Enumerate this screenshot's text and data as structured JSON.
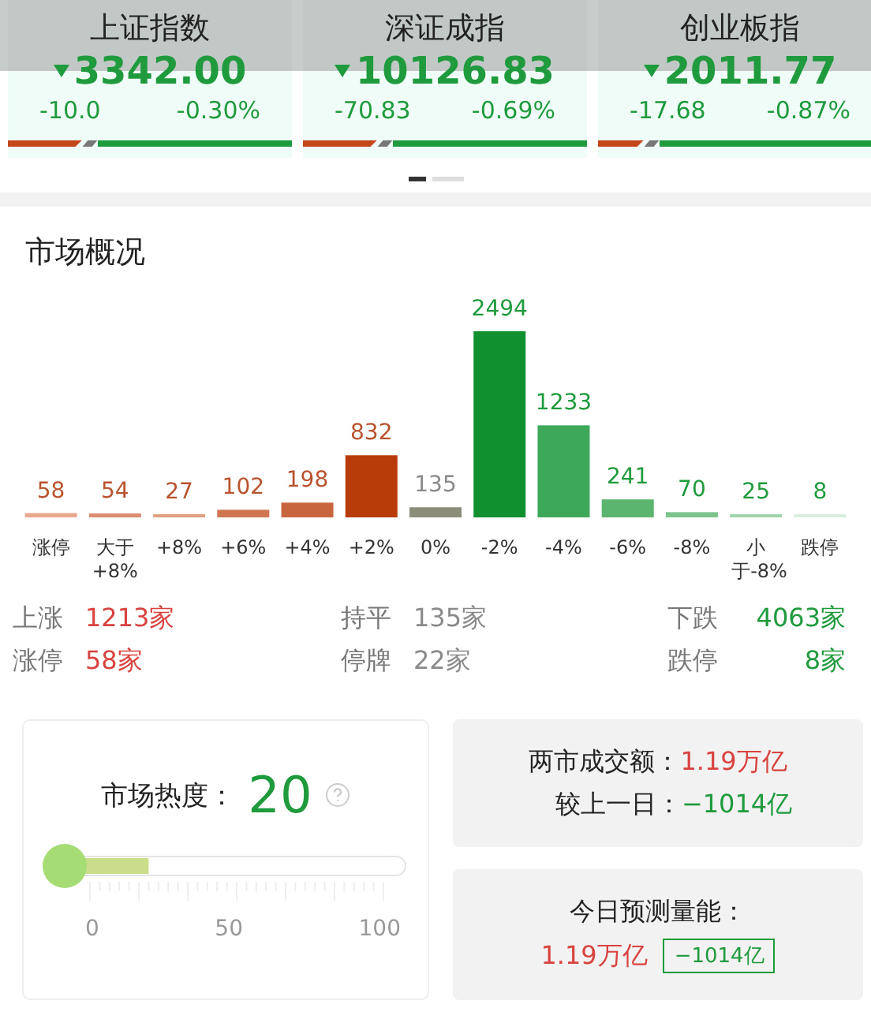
{
  "indices": [
    {
      "name": "上证指数",
      "color": "#1f9a3c",
      "price": "3342.00",
      "change": "-10.0",
      "percent": "-0.30%",
      "bar": {
        "level": 0.26
      }
    },
    {
      "name": "深证成指",
      "color": "#1f9a3c",
      "price": "10126.83",
      "change": "-70.83",
      "percent": "-0.69%",
      "bar": {
        "level": 0.26
      }
    },
    {
      "name": "创业板指",
      "color": "#1f9a3c",
      "price": "2011.77",
      "change": "-17.68",
      "percent": "-0.87%",
      "bar": {
        "level": 0.16
      }
    }
  ],
  "pager": [
    {
      "selected": true
    },
    {
      "selected": false
    }
  ],
  "overview": {
    "title": "市场概况",
    "chart_data": {
      "type": "bar",
      "categories": [
        "涨停",
        "大于+8%",
        "+8%",
        "+6%",
        "+4%",
        "+2%",
        "0%",
        "-2%",
        "-4%",
        "-6%",
        "-8%",
        "小于-8%",
        "跌停"
      ],
      "values": [
        58,
        54,
        27,
        102,
        198,
        832,
        135,
        2494,
        1233,
        241,
        70,
        25,
        8
      ],
      "data_labels": true
    },
    "bars": [
      {
        "color": "#e9a98f"
      },
      {
        "color": "#dc8e72"
      },
      {
        "color": "#e0a080"
      },
      {
        "color": "#cf7650"
      },
      {
        "color": "#c9653e"
      },
      {
        "color": "#b83c0a"
      },
      {
        "color": "#8c8c7a"
      },
      {
        "color": "#10902f"
      },
      {
        "color": "#3ea85a"
      },
      {
        "color": "#5bb56f"
      },
      {
        "color": "#7cc48c"
      },
      {
        "color": "#9fd4ab"
      },
      {
        "color": "#d9eedd"
      }
    ],
    "labels": [
      {
        "color": "#b9532e"
      },
      {
        "color": "#b9532e"
      },
      {
        "color": "#b9532e"
      },
      {
        "color": "#b9532e"
      },
      {
        "color": "#b9532e"
      },
      {
        "color": "#b9532e"
      },
      {
        "color": "#8a8a8a"
      },
      {
        "color": "#1f9a3c"
      },
      {
        "color": "#1f9a3c"
      },
      {
        "color": "#1f9a3c"
      },
      {
        "color": "#1f9a3c"
      },
      {
        "color": "#1f9a3c"
      },
      {
        "color": "#1f9a3c"
      }
    ],
    "stats": [
      {
        "label": "上涨",
        "value": "1213家",
        "color": "#d9433f"
      },
      {
        "label": "持平",
        "value": "135家",
        "color": "#8a8a8a"
      },
      {
        "label": "下跌",
        "value": "4063家",
        "color": "#1f9a3c"
      },
      {
        "label": "涨停",
        "value": "58家",
        "color": "#d9433f"
      },
      {
        "label": "停牌",
        "value": "22家",
        "color": "#8a8a8a"
      },
      {
        "label": "跌停",
        "value": "8家",
        "color": "#1f9a3c"
      }
    ]
  },
  "heat": {
    "label": "市场热度：",
    "value": "20",
    "meter": {
      "level": 0.2
    },
    "ticks": [
      "0",
      "50",
      "100"
    ]
  },
  "turnover": {
    "rows": [
      {
        "label": "两市成交额：",
        "value": "1.19万亿",
        "color": "#d9433f"
      },
      {
        "label": "较上一日：",
        "value": "−1014亿",
        "color": "#1f9a3c"
      }
    ]
  },
  "forecast": {
    "label": "今日预测量能：",
    "value": "1.19万亿",
    "delta": "−1014亿"
  }
}
